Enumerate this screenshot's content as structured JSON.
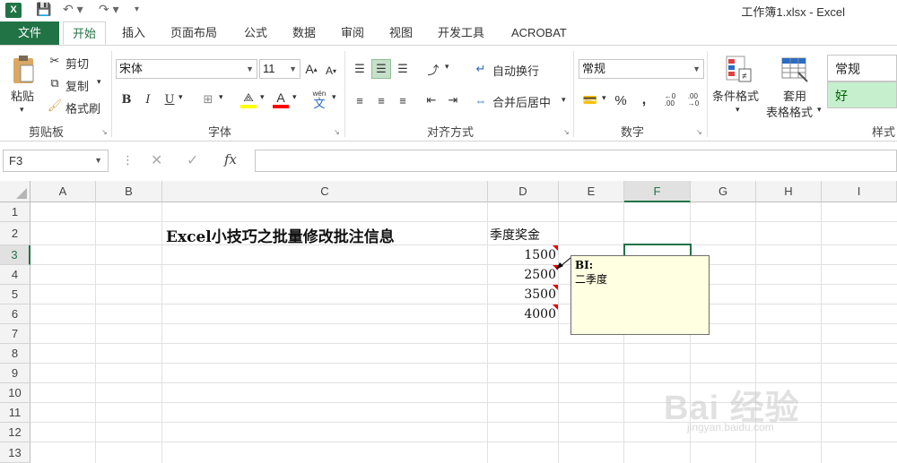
{
  "window": {
    "title": "工作簿1.xlsx - Excel",
    "app_icon": "X"
  },
  "tabs": [
    "文件",
    "开始",
    "插入",
    "页面布局",
    "公式",
    "数据",
    "审阅",
    "视图",
    "开发工具",
    "ACROBAT"
  ],
  "clipboard": {
    "paste": "粘贴",
    "cut": "剪切",
    "copy": "复制",
    "format_painter": "格式刷",
    "group": "剪贴板"
  },
  "font": {
    "name": "宋体",
    "size": "11",
    "group": "字体",
    "bold": "B",
    "italic": "I",
    "underline": "U",
    "phonetic": "wén"
  },
  "alignment": {
    "wrap": "自动换行",
    "merge": "合并后居中",
    "group": "对齐方式"
  },
  "number": {
    "format": "常规",
    "group": "数字",
    "percent": "%",
    "comma": ","
  },
  "styles": {
    "conditional": "条件格式",
    "table_line1": "套用",
    "table_line2": "表格格式",
    "normal": "常规",
    "good": "好",
    "group": "样式"
  },
  "formula_bar": {
    "name_box": "F3",
    "fx": "fx",
    "value": ""
  },
  "columns": [
    "A",
    "B",
    "C",
    "D",
    "E",
    "F",
    "G",
    "H",
    "I"
  ],
  "rows": [
    "1",
    "2",
    "3",
    "4",
    "5",
    "6",
    "7",
    "8",
    "9",
    "10",
    "11",
    "12",
    "13"
  ],
  "cells": {
    "C2": "Excel小技巧之批量修改批注信息",
    "D2": "季度奖金",
    "D3": "1500",
    "D4": "2500",
    "D5": "3500",
    "D6": "4000"
  },
  "comment": {
    "author": "BI:",
    "text": "二季度"
  },
  "watermark": {
    "brand": "Bai 经验",
    "url": "jingyan.baidu.com"
  }
}
